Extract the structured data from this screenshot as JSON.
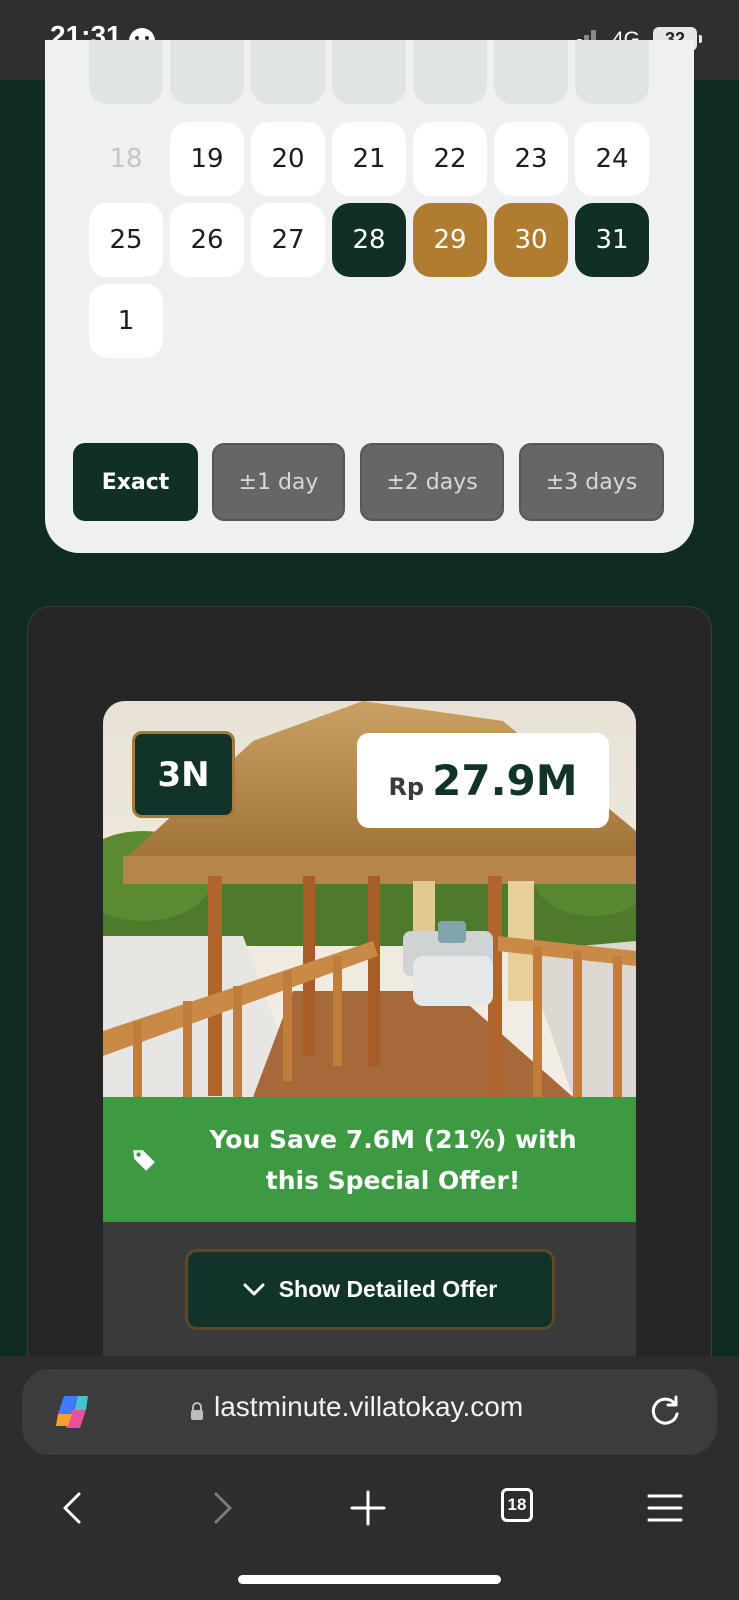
{
  "status_bar": {
    "time": "21:31",
    "network": "4G",
    "battery": "32"
  },
  "calendar": {
    "days": [
      {
        "label": "18",
        "state": "muted"
      },
      {
        "label": "19",
        "state": "normal"
      },
      {
        "label": "20",
        "state": "normal"
      },
      {
        "label": "21",
        "state": "normal"
      },
      {
        "label": "22",
        "state": "normal"
      },
      {
        "label": "23",
        "state": "normal"
      },
      {
        "label": "24",
        "state": "normal"
      },
      {
        "label": "25",
        "state": "normal"
      },
      {
        "label": "26",
        "state": "normal"
      },
      {
        "label": "27",
        "state": "normal"
      },
      {
        "label": "28",
        "state": "range-start"
      },
      {
        "label": "29",
        "state": "in-range"
      },
      {
        "label": "30",
        "state": "in-range"
      },
      {
        "label": "31",
        "state": "range-end"
      },
      {
        "label": "1",
        "state": "normal"
      }
    ],
    "flex_options": [
      {
        "label": "Exact",
        "active": true
      },
      {
        "label": "±1 day",
        "active": false
      },
      {
        "label": "±2 days",
        "active": false
      },
      {
        "label": "±3 days",
        "active": false
      }
    ],
    "colors": {
      "range_end": "#0f2f27",
      "in_range": "#b07c2f"
    }
  },
  "offer": {
    "nights": "3N",
    "currency": "Rp",
    "price": "27.9M",
    "savings_line1": "You Save 7.6M (21%) with",
    "savings_line2": "this Special Offer!",
    "detail_button": "Show Detailed Offer",
    "colors": {
      "savings_banner": "#3d9a42",
      "badge_border": "#a57b38"
    }
  },
  "browser": {
    "url": "lastminute.villatokay.com",
    "tab_count": "18",
    "icons": [
      "copilot-icon",
      "lock-icon",
      "reload-icon",
      "back-icon",
      "forward-icon",
      "new-tab-icon",
      "tabs-icon",
      "menu-icon"
    ]
  }
}
